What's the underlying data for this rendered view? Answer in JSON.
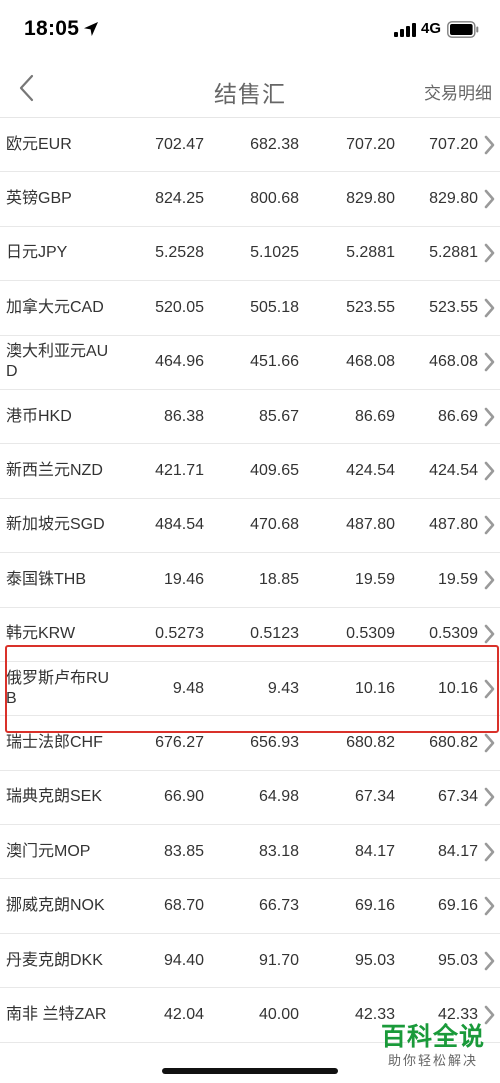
{
  "status_bar": {
    "time": "18:05",
    "network": "4G",
    "icons": [
      "location-arrow-icon",
      "signal-icon",
      "battery-icon"
    ]
  },
  "nav": {
    "title": "结售汇",
    "action": "交易明细",
    "back_icon": "chevron-left-icon"
  },
  "rates": [
    {
      "name": "欧元EUR",
      "values": [
        "702.47",
        "682.38",
        "707.20",
        "707.20"
      ]
    },
    {
      "name": "英镑GBP",
      "values": [
        "824.25",
        "800.68",
        "829.80",
        "829.80"
      ]
    },
    {
      "name": "日元JPY",
      "values": [
        "5.2528",
        "5.1025",
        "5.2881",
        "5.2881"
      ]
    },
    {
      "name": "加拿大元CAD",
      "values": [
        "520.05",
        "505.18",
        "523.55",
        "523.55"
      ]
    },
    {
      "name": "澳大利亚元AUD",
      "values": [
        "464.96",
        "451.66",
        "468.08",
        "468.08"
      ]
    },
    {
      "name": "港币HKD",
      "values": [
        "86.38",
        "85.67",
        "86.69",
        "86.69"
      ]
    },
    {
      "name": "新西兰元NZD",
      "values": [
        "421.71",
        "409.65",
        "424.54",
        "424.54"
      ]
    },
    {
      "name": "新加坡元SGD",
      "values": [
        "484.54",
        "470.68",
        "487.80",
        "487.80"
      ]
    },
    {
      "name": "泰国铢THB",
      "values": [
        "19.46",
        "18.85",
        "19.59",
        "19.59"
      ]
    },
    {
      "name": "韩元KRW",
      "values": [
        "0.5273",
        "0.5123",
        "0.5309",
        "0.5309"
      ]
    },
    {
      "name": "俄罗斯卢布RUB",
      "values": [
        "9.48",
        "9.43",
        "10.16",
        "10.16"
      ]
    },
    {
      "name": "瑞士法郎CHF",
      "values": [
        "676.27",
        "656.93",
        "680.82",
        "680.82"
      ]
    },
    {
      "name": "瑞典克朗SEK",
      "values": [
        "66.90",
        "64.98",
        "67.34",
        "67.34"
      ]
    },
    {
      "name": "澳门元MOP",
      "values": [
        "83.85",
        "83.18",
        "84.17",
        "84.17"
      ]
    },
    {
      "name": "挪威克朗NOK",
      "values": [
        "68.70",
        "66.73",
        "69.16",
        "69.16"
      ]
    },
    {
      "name": "丹麦克朗DKK",
      "values": [
        "94.40",
        "91.70",
        "95.03",
        "95.03"
      ]
    },
    {
      "name": "南非 兰特ZAR",
      "values": [
        "42.04",
        "40.00",
        "42.33",
        "42.33"
      ]
    }
  ],
  "highlight_color": "#d9312a",
  "watermark": {
    "title": "百科全说",
    "subtitle": "助你轻松解决",
    "color": "#1a9a3a"
  }
}
